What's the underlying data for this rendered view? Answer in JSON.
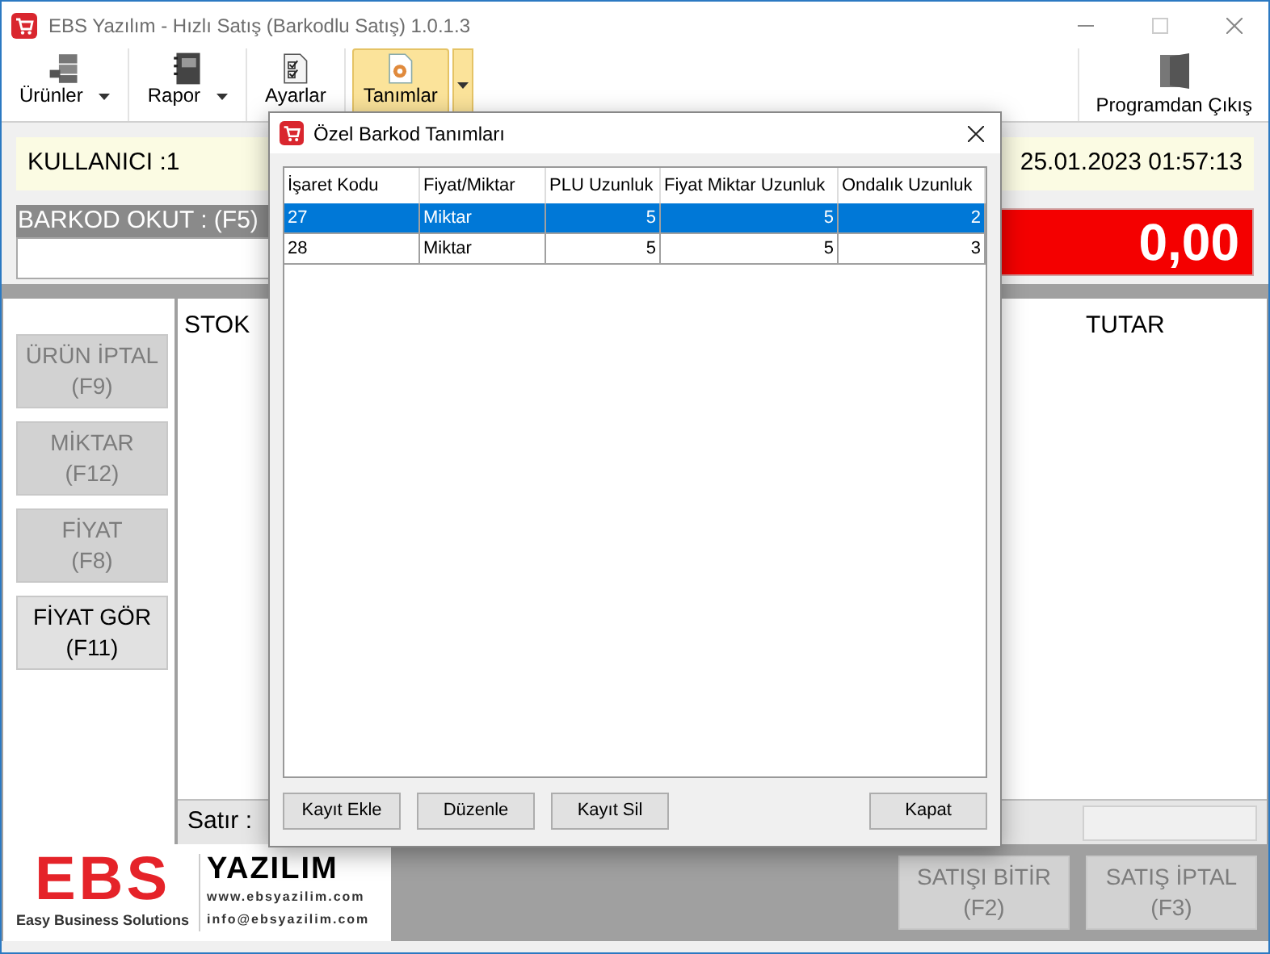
{
  "window": {
    "title": "EBS Yazılım - Hızlı Satış (Barkodlu Satış) 1.0.1.3"
  },
  "toolbar": [
    {
      "label": "Ürünler",
      "kind": "dropdown",
      "selected": false
    },
    {
      "label": "Rapor",
      "kind": "dropdown",
      "selected": false
    },
    {
      "label": "Ayarlar",
      "kind": "plain",
      "selected": false
    },
    {
      "label": "Tanımlar",
      "kind": "split",
      "selected": true
    }
  ],
  "exit_button": "Programdan Çıkış",
  "info_bar": {
    "user": "KULLANICI :1",
    "datetime": "25.01.2023 01:57:13"
  },
  "barcode": {
    "label": "BARKOD OKUT : (F5)"
  },
  "total": "0,00",
  "side_buttons": [
    {
      "label": "ÜRÜN İPTAL",
      "key": "(F9)",
      "disabled": true
    },
    {
      "label": "MİKTAR",
      "key": "(F12)",
      "disabled": true
    },
    {
      "label": "FİYAT",
      "key": "(F8)",
      "disabled": true
    },
    {
      "label": "FİYAT GÖR",
      "key": "(F11)",
      "disabled": false
    }
  ],
  "sales_table": {
    "columns": [
      "STOK",
      "TUTAR"
    ],
    "footer": "Satır :"
  },
  "logo": {
    "brand": "EBS",
    "tagline": "Easy Business Solutions",
    "name": "YAZILIM",
    "web": "www.ebsyazilim.com",
    "email": "info@ebsyazilim.com"
  },
  "bottom_buttons": [
    {
      "label": "SATIŞI BİTİR",
      "key": "(F2)",
      "disabled": true
    },
    {
      "label": "SATIŞ İPTAL",
      "key": "(F3)",
      "disabled": true
    }
  ],
  "dialog": {
    "title": "Özel Barkod Tanımları",
    "columns": [
      "İşaret Kodu",
      "Fiyat/Miktar",
      "PLU Uzunluk",
      "Fiyat Miktar Uzunluk",
      "Ondalık Uzunluk"
    ],
    "rows": [
      {
        "cells": [
          "27",
          "Miktar",
          "5",
          "5",
          "2"
        ],
        "selected": true
      },
      {
        "cells": [
          "28",
          "Miktar",
          "5",
          "5",
          "3"
        ],
        "selected": false
      }
    ],
    "buttons": [
      "Kayıt Ekle",
      "Düzenle",
      "Kayıt Sil"
    ],
    "close_button": "Kapat"
  }
}
